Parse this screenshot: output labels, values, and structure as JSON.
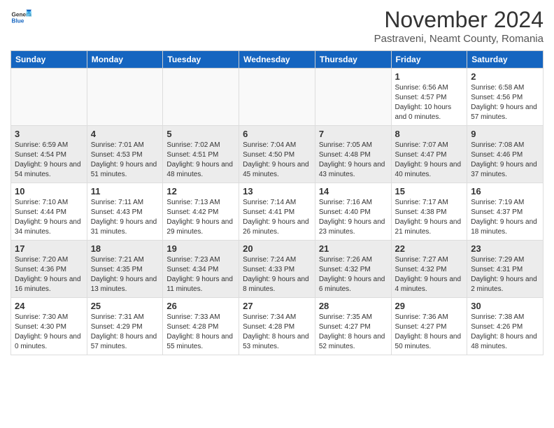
{
  "header": {
    "logo_general": "General",
    "logo_blue": "Blue",
    "title": "November 2024",
    "location": "Pastraveni, Neamt County, Romania"
  },
  "calendar": {
    "days_of_week": [
      "Sunday",
      "Monday",
      "Tuesday",
      "Wednesday",
      "Thursday",
      "Friday",
      "Saturday"
    ],
    "weeks": [
      [
        {
          "day": "",
          "info": ""
        },
        {
          "day": "",
          "info": ""
        },
        {
          "day": "",
          "info": ""
        },
        {
          "day": "",
          "info": ""
        },
        {
          "day": "",
          "info": ""
        },
        {
          "day": "1",
          "info": "Sunrise: 6:56 AM\nSunset: 4:57 PM\nDaylight: 10 hours and 0 minutes."
        },
        {
          "day": "2",
          "info": "Sunrise: 6:58 AM\nSunset: 4:56 PM\nDaylight: 9 hours and 57 minutes."
        }
      ],
      [
        {
          "day": "3",
          "info": "Sunrise: 6:59 AM\nSunset: 4:54 PM\nDaylight: 9 hours and 54 minutes."
        },
        {
          "day": "4",
          "info": "Sunrise: 7:01 AM\nSunset: 4:53 PM\nDaylight: 9 hours and 51 minutes."
        },
        {
          "day": "5",
          "info": "Sunrise: 7:02 AM\nSunset: 4:51 PM\nDaylight: 9 hours and 48 minutes."
        },
        {
          "day": "6",
          "info": "Sunrise: 7:04 AM\nSunset: 4:50 PM\nDaylight: 9 hours and 45 minutes."
        },
        {
          "day": "7",
          "info": "Sunrise: 7:05 AM\nSunset: 4:48 PM\nDaylight: 9 hours and 43 minutes."
        },
        {
          "day": "8",
          "info": "Sunrise: 7:07 AM\nSunset: 4:47 PM\nDaylight: 9 hours and 40 minutes."
        },
        {
          "day": "9",
          "info": "Sunrise: 7:08 AM\nSunset: 4:46 PM\nDaylight: 9 hours and 37 minutes."
        }
      ],
      [
        {
          "day": "10",
          "info": "Sunrise: 7:10 AM\nSunset: 4:44 PM\nDaylight: 9 hours and 34 minutes."
        },
        {
          "day": "11",
          "info": "Sunrise: 7:11 AM\nSunset: 4:43 PM\nDaylight: 9 hours and 31 minutes."
        },
        {
          "day": "12",
          "info": "Sunrise: 7:13 AM\nSunset: 4:42 PM\nDaylight: 9 hours and 29 minutes."
        },
        {
          "day": "13",
          "info": "Sunrise: 7:14 AM\nSunset: 4:41 PM\nDaylight: 9 hours and 26 minutes."
        },
        {
          "day": "14",
          "info": "Sunrise: 7:16 AM\nSunset: 4:40 PM\nDaylight: 9 hours and 23 minutes."
        },
        {
          "day": "15",
          "info": "Sunrise: 7:17 AM\nSunset: 4:38 PM\nDaylight: 9 hours and 21 minutes."
        },
        {
          "day": "16",
          "info": "Sunrise: 7:19 AM\nSunset: 4:37 PM\nDaylight: 9 hours and 18 minutes."
        }
      ],
      [
        {
          "day": "17",
          "info": "Sunrise: 7:20 AM\nSunset: 4:36 PM\nDaylight: 9 hours and 16 minutes."
        },
        {
          "day": "18",
          "info": "Sunrise: 7:21 AM\nSunset: 4:35 PM\nDaylight: 9 hours and 13 minutes."
        },
        {
          "day": "19",
          "info": "Sunrise: 7:23 AM\nSunset: 4:34 PM\nDaylight: 9 hours and 11 minutes."
        },
        {
          "day": "20",
          "info": "Sunrise: 7:24 AM\nSunset: 4:33 PM\nDaylight: 9 hours and 8 minutes."
        },
        {
          "day": "21",
          "info": "Sunrise: 7:26 AM\nSunset: 4:32 PM\nDaylight: 9 hours and 6 minutes."
        },
        {
          "day": "22",
          "info": "Sunrise: 7:27 AM\nSunset: 4:32 PM\nDaylight: 9 hours and 4 minutes."
        },
        {
          "day": "23",
          "info": "Sunrise: 7:29 AM\nSunset: 4:31 PM\nDaylight: 9 hours and 2 minutes."
        }
      ],
      [
        {
          "day": "24",
          "info": "Sunrise: 7:30 AM\nSunset: 4:30 PM\nDaylight: 9 hours and 0 minutes."
        },
        {
          "day": "25",
          "info": "Sunrise: 7:31 AM\nSunset: 4:29 PM\nDaylight: 8 hours and 57 minutes."
        },
        {
          "day": "26",
          "info": "Sunrise: 7:33 AM\nSunset: 4:28 PM\nDaylight: 8 hours and 55 minutes."
        },
        {
          "day": "27",
          "info": "Sunrise: 7:34 AM\nSunset: 4:28 PM\nDaylight: 8 hours and 53 minutes."
        },
        {
          "day": "28",
          "info": "Sunrise: 7:35 AM\nSunset: 4:27 PM\nDaylight: 8 hours and 52 minutes."
        },
        {
          "day": "29",
          "info": "Sunrise: 7:36 AM\nSunset: 4:27 PM\nDaylight: 8 hours and 50 minutes."
        },
        {
          "day": "30",
          "info": "Sunrise: 7:38 AM\nSunset: 4:26 PM\nDaylight: 8 hours and 48 minutes."
        }
      ]
    ]
  }
}
